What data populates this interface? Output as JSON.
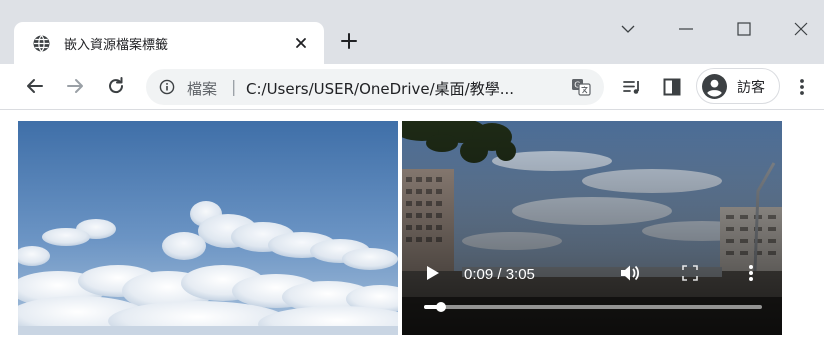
{
  "tab": {
    "title": "嵌入資源檔案標籤",
    "favicon": "globe-icon",
    "close": "close-icon"
  },
  "new_tab": "plus-icon",
  "window_controls": [
    "chevron-down-icon",
    "minimize-icon",
    "maximize-icon",
    "close-icon"
  ],
  "toolbar": {
    "back": "arrow-left-icon",
    "forward": "arrow-right-icon",
    "reload": "reload-icon",
    "omnibox": {
      "security_icon": "info-icon",
      "prefix": "檔案",
      "separator": "|",
      "url": "C:/Users/USER/OneDrive/桌面/教學..."
    },
    "translate": "translate-icon",
    "reading_list": "reading-list-icon",
    "side_panel": "side-panel-icon",
    "profile": {
      "avatar": "person-icon",
      "name": "訪客"
    },
    "menu": "kebab-menu-icon"
  },
  "content": {
    "image": {
      "subject": "sky-with-clouds"
    },
    "video": {
      "time": "0:09 / 3:05",
      "progress": 0.049,
      "controls": [
        "play-icon",
        "volume-icon",
        "fullscreen-icon",
        "more-options-icon"
      ]
    }
  },
  "colors": {
    "tabstrip": "#dee1e6",
    "omnibox": "#f1f3f4",
    "icon": "#5f6368"
  }
}
